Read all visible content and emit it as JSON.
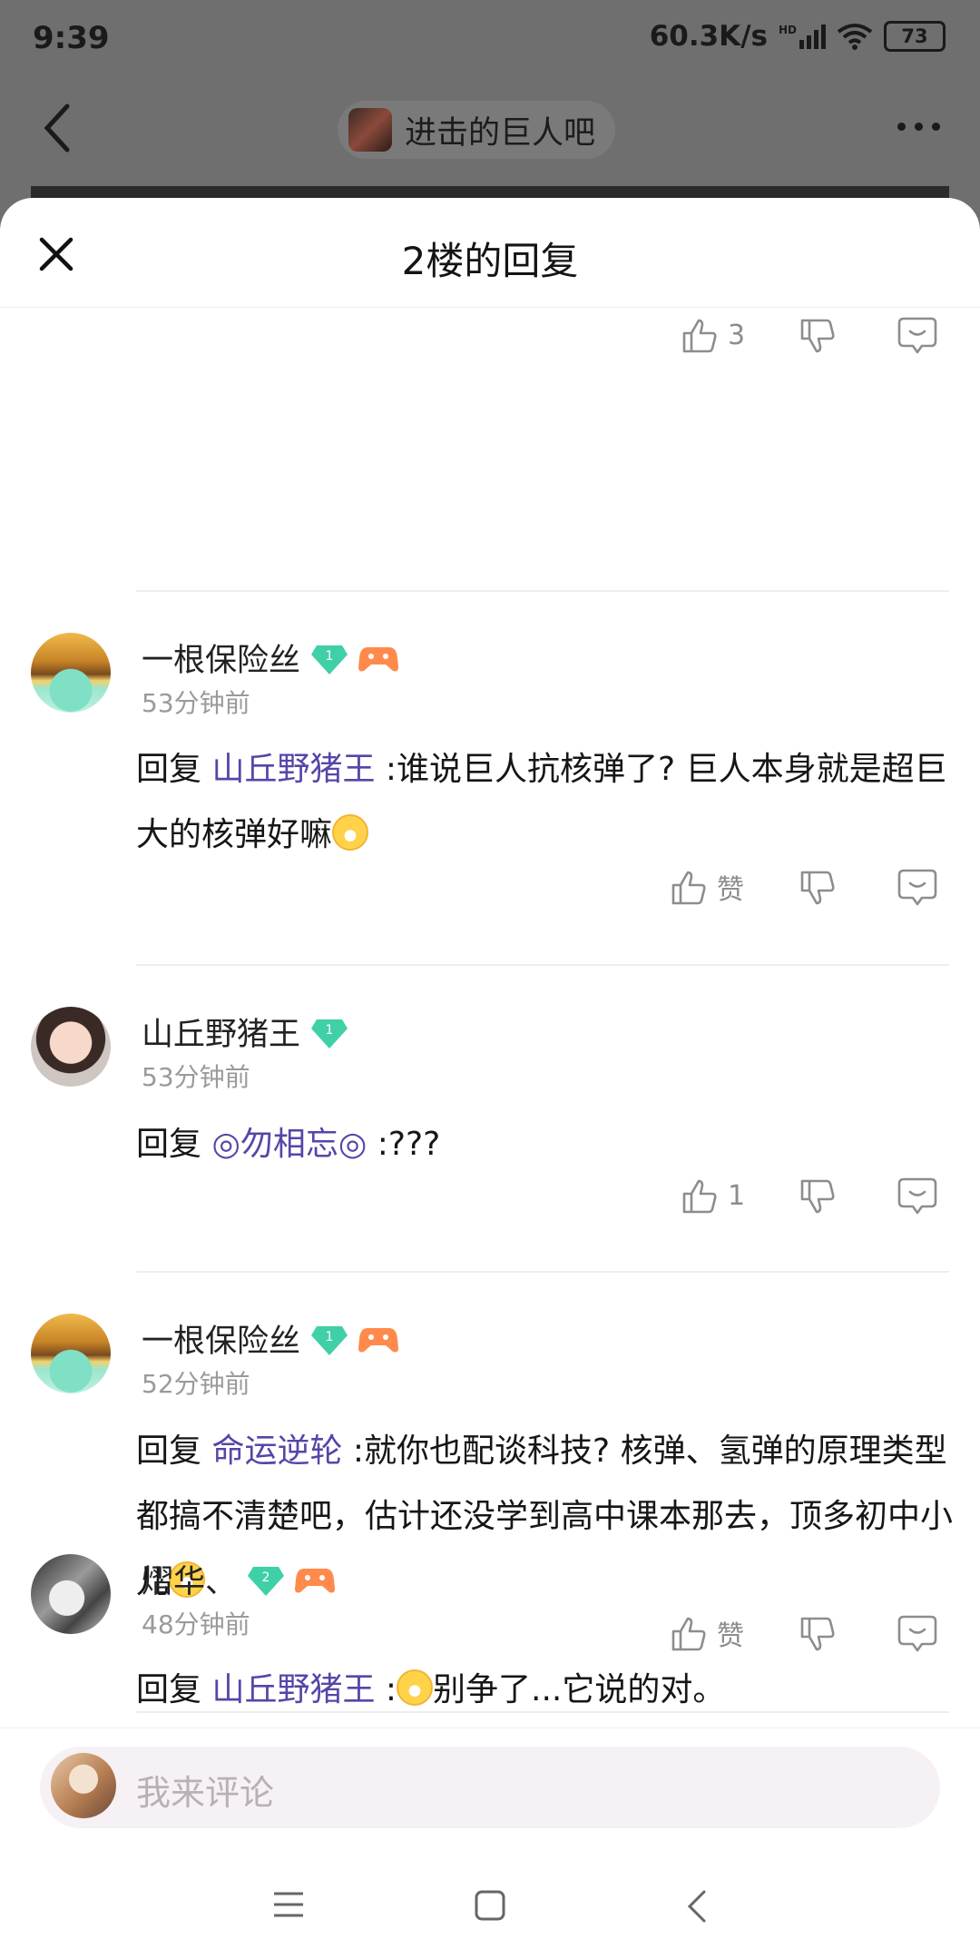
{
  "status_bar": {
    "time": "9:39",
    "speed": "60.3K/s",
    "network": "HD",
    "battery": "73"
  },
  "top_nav": {
    "forum_name": "进击的巨人吧"
  },
  "sheet": {
    "title": "2楼的回复"
  },
  "top_actions": {
    "like_count": "3"
  },
  "comments": [
    {
      "name": "一根保险丝",
      "level": "1",
      "time": "53分钟前",
      "reply_prefix": "回复 ",
      "mention": "山丘野猪王",
      "text": " :谁说巨人抗核弹了? 巨人本身就是超巨大的核弹好嘛",
      "like": "赞"
    },
    {
      "name": "山丘野猪王",
      "level": "1",
      "time": "53分钟前",
      "reply_prefix": "回复 ",
      "mention": "◎勿相忘◎",
      "text": " :???",
      "like": "1"
    },
    {
      "name": "一根保险丝",
      "level": "1",
      "time": "52分钟前",
      "reply_prefix": "回复 ",
      "mention": "命运逆轮",
      "text": " :就你也配谈科技? 核弹、氢弹的原理类型都搞不清楚吧，估计还没学到高中课本那去，顶多初中小儿",
      "like": "赞"
    },
    {
      "name": "熠华、",
      "level": "2",
      "time": "48分钟前",
      "reply_prefix": "回复 ",
      "mention": "山丘野猪王",
      "text": "别争了...它说的对。",
      "like": ""
    }
  ],
  "input": {
    "placeholder": "我来评论"
  },
  "colors": {
    "mention": "#5546a7",
    "level_badge": "#3fd0a8",
    "game_badge": "#ff8a4c"
  }
}
